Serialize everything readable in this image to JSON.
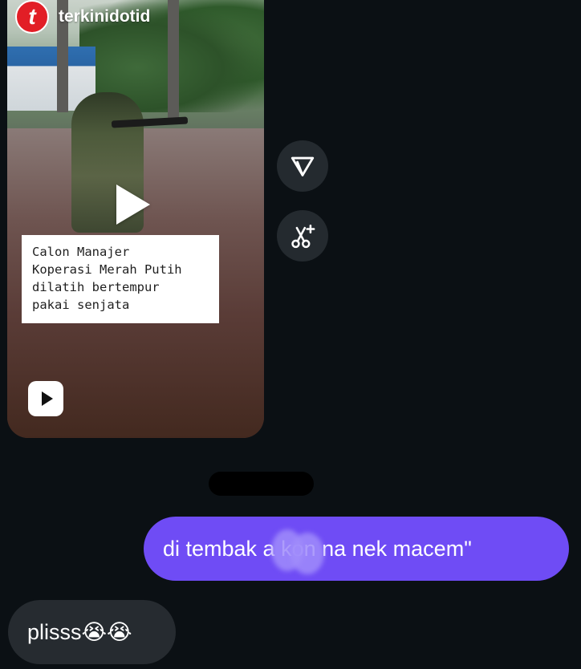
{
  "shared_post": {
    "account_name": "terkinidotid",
    "logo_letter": "t",
    "caption_lines": [
      "Calon Manajer",
      "Koperasi Merah Putih",
      "dilatih bertempur",
      "pakai senjata"
    ],
    "play_icon": "play-icon",
    "reels_icon": "reels-icon"
  },
  "side_actions": {
    "share_icon": "send-icon",
    "remix_icon": "scissors-sparkle-icon"
  },
  "messages": [
    {
      "direction": "outgoing",
      "text": "di tembak     a kon na nek macem\""
    },
    {
      "direction": "incoming",
      "text": "plisss😭😭"
    }
  ],
  "colors": {
    "background": "#0b1014",
    "outgoing_bubble": "#6f4cf5",
    "incoming_bubble": "#262b30",
    "side_button": "#242a2f",
    "logo_red": "#e21e26"
  }
}
